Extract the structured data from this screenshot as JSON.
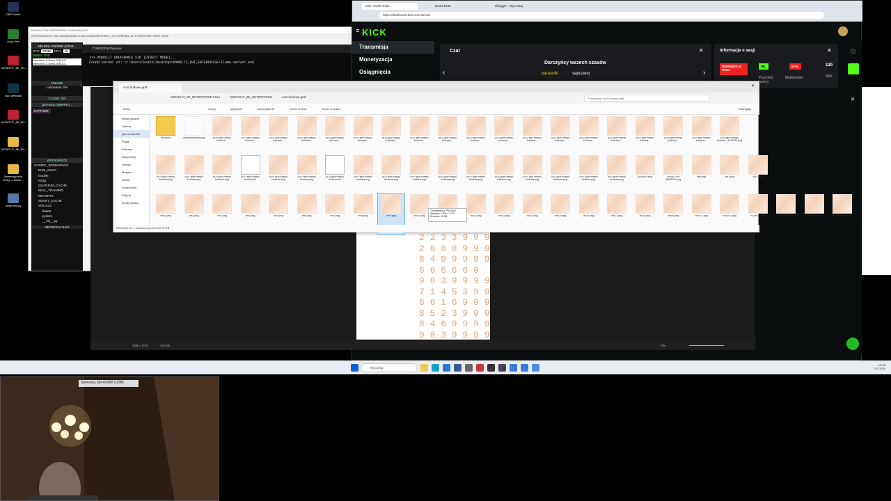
{
  "desktop": {
    "icons": [
      {
        "label": "OBS Studio",
        "color": "#223355"
      },
      {
        "label": "nowy llxxt",
        "color": "#2e7d32"
      },
      {
        "label": "MONOLIT_IBI_EN...",
        "color": "#b23"
      },
      {
        "label": "Iriun Webcam",
        "color": "#134"
      },
      {
        "label": "MONOLIT_IBI_EN...",
        "color": "#b23"
      },
      {
        "label": "MONOLIT_IBI_EN...",
        "color": "#e8b84a"
      },
      {
        "label": "Matematyczny mózg — kopia ...",
        "color": "#e8b84a"
      },
      {
        "label": "nowy llxxt.py",
        "color": "#5578aa"
      }
    ]
  },
  "monolit": {
    "title": "MONOLIT IBI ENTERPRISE V.MAXIMA.AIOS",
    "menu": "Plik   KNOWLEDGE   Tools   ZARZĄDZANIE   CLANG   TASKS   ARCHITEKT_LOG   INTERNAL_AI   OPTIONS   HELP   NODE   Theme",
    "neural_engine": "NEURAL ENGINE (STAR...",
    "ctx_label": "CTX:",
    "ctx_value": "99999",
    "cpu_label": "CPU:",
    "cpu_value": "16",
    "status": "(status: ON)",
    "models": [
      "Nemotron-3-Nano-30B-A3...",
      "Nemotron-3-Nano-30B-A3..."
    ],
    "online": "ONLINE",
    "ladowanie": "Ładowanie: 0%",
    "cache": "CACHE: ON",
    "quarks": "QUARKS (SNIPPET...",
    "capture": "CAPTURE",
    "workspace": "WORKSPACE",
    "tree": [
      "COSMIC_WORKSPACE",
      "DISK_SWAP",
      "models",
      "mózg",
      "QUANTUM_CACHE",
      "REAL_TRAINING",
      "REPORTS",
      "SMART_CACHE",
      "VISUALS",
      "flake8",
      "pylintrc",
      "__init__.py"
    ],
    "refresh": "REFRESH FILES"
  },
  "cmd": {
    "title": "C:\\WINDOWS\\py.exe",
    "lines": [
      ">>> MONOLIT URUCHAMIA SIĘ (DIRECT MODE)...",
      "Found server at: C:\\Users\\kazik\\Desktop\\MONOLIT_IBI_ENTERPRISE\\llama-server.exe"
    ]
  },
  "browser": {
    "tabs": [
      "Kick: uruch mówi...",
      "Nowa karta",
      "ailloggin - Wyszukaj"
    ],
    "url": "https://dashboard.kick.com/stream",
    "kick_logo": "KICK",
    "nav": [
      "Transmisja",
      "Monetyzacja",
      "Osiągnięcia"
    ],
    "chat_title": "Czat",
    "chat_header": "Darczyńcy wszech czasów",
    "chat_users": [
      "parasolki",
      "sapczano"
    ],
    "info_title": "Informacje o sesji",
    "live_badge": "TRANSMISJA TRWA",
    "wl_badge": "WŁ.",
    "wyl_badge": "WYŁ.",
    "przychod": "Przychód twórcy",
    "multistream": "Multistream",
    "views": "120",
    "wid": "Wid"
  },
  "explorer": {
    "tab": "AoS budowa graf",
    "breadcrumb": [
      "MONOLIT_IBI_ENTERPRISE FULL",
      "MONOLIT_IBI_ENTERPRISE",
      "AoS budowa graf"
    ],
    "search": "Przeszukaj: AoS budowa graf",
    "toolbar": [
      "Nowy",
      "Sortuj",
      "Wyświetl",
      "Ustaw jako tło",
      "Obróć w lewo",
      "Obróć w prawo",
      "Szczegóły"
    ],
    "pane": [
      "Widok główny",
      "Galeria",
      "Igor w rodzinie",
      "Pulpit",
      "Pobrane",
      "Dokumenty",
      "Obrazy",
      "Muzyka",
      "Wideo",
      "Nowy folder",
      "Zdjęcia",
      "Zrzuty ekranu"
    ],
    "files_row1": [
      "decoded",
      "aaaaaaaaaaaa.png",
      "AGS graf matryc budowa...",
      "AGS graf matryc budowa...",
      "AGS graf matryc budowa...",
      "AGS graf matryc budowa...",
      "AGS graf matryc budowa...",
      "AGS graf matryc budowa...",
      "AGS graf matryc budowa...",
      "AGS graf matryc budowa...",
      "AGS graf matryc budowa...",
      "AGS graf matryc budowa...",
      "AGS graf matryc budowa...",
      "AGS graf matryc budowa...",
      "AGS graf matryc budowa...",
      "AGS graf matryc budowa...",
      "AGS graf matryc budowa...",
      "AGS graf matryc budowa...",
      "AGS graf matryc budowa...",
      "AGS graf matryc budowa...",
      "AGS graf matryc budowa...4443333.png"
    ],
    "files_row2": [
      "AGS graf matryc budowa.png",
      "AGS graf matryc budowa.png",
      "AGS graf matryc budowa.png",
      "AGS graf matryc budowa.txt",
      "AGS graf matryc budowa.png",
      "AGS graf matryc budowa.png",
      "AGS graf matryc budowa.txt",
      "AGS graf matryc budowa.png",
      "AGS graf matryc budowa.png",
      "AGS graf matryc budowa.png",
      "AGS graf matryc budowa.png",
      "AGS graf matryc budowa.png",
      "AGS graf matryc budowa.png",
      "AGS graf matryc budowa.png",
      "AGS graf matryc budowa.png",
      "AGS graf matryc budowa.png",
      "AGS graf matryc budowa.png",
      "4005000.png",
      "TAMATORA 4WADDA.png",
      "new.png",
      "ver1.png",
      "ver2.png"
    ],
    "files_row3": [
      "vmo1.png",
      "vm2.png",
      "vm3.png",
      "vm4.png",
      "vm5.png",
      "vm6.png",
      "vm7.png",
      "vm8.png",
      "vm9.png",
      "vm10.png",
      "vm11.png",
      "vm12.png",
      "vm13.png",
      "vm14.png",
      "vm15.png",
      "vm16.png",
      "vm17.png",
      "vm18.png",
      "vm19.png",
      "vm19 2.png",
      "NOWE1.png",
      "NOWE2.png",
      "NOWE3.png",
      "NOWE4.png",
      "aaaaaaaaaaa.png"
    ],
    "status": "Elementy: 91    1 zaznaczony element  92 KB",
    "tooltip": [
      "Typ elementu: Plik PNG",
      "Wymiary: 1256 x 1703",
      "Rozmiar: 19 KB"
    ]
  },
  "viewer": {
    "numbers": [
      "2 2 3 3 9 9 9",
      "2 8 8 8 9 9 9",
      "8 4 9 9 9 9 9",
      "6 6 6 6 6 9",
      "9 8 3 9 9 9 9",
      "7 1 4 5 3 9 9 9",
      "6 6 1 6 9 9 9 9",
      "8 5 2 3 9 9 9 9",
      "8 4 6 9 9 9 9 9",
      "9 8 3 9 9 9 9 9"
    ],
    "zoom": "73%",
    "dims": "1256 × 1703",
    "size": "19,5 KB"
  },
  "taskbar": {
    "search": "Wyszukaj",
    "time": "15:48",
    "date": "7.01.2026"
  },
  "webcam": {
    "label": "Samsung SM-A546B (USB)"
  }
}
